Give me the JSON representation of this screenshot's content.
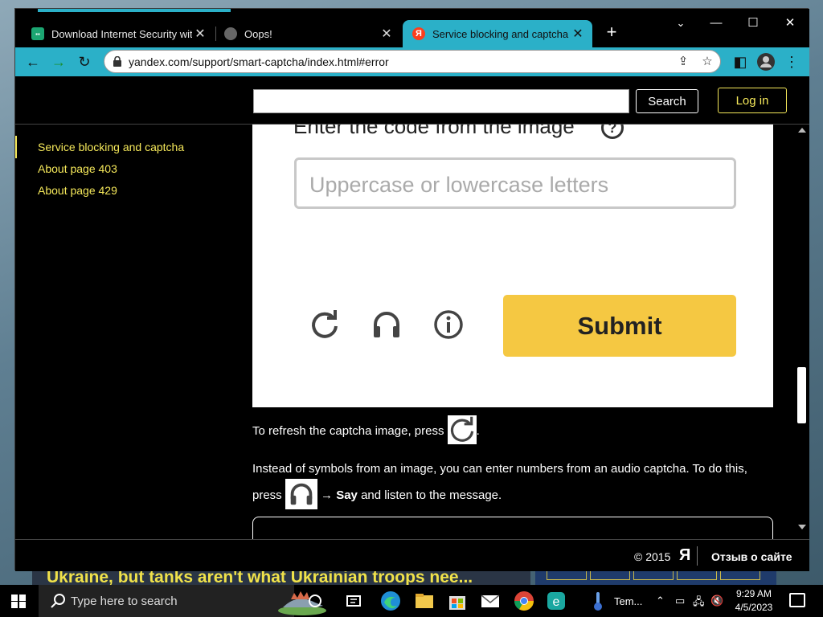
{
  "browser": {
    "tabs": [
      {
        "title": "Download Internet Security with",
        "favicon": "kaspersky-icon"
      },
      {
        "title": "Oops!",
        "favicon": "globe-icon"
      },
      {
        "title": "Service blocking and captcha",
        "favicon": "yandex-icon",
        "active": true
      }
    ],
    "new_tab": "+",
    "url": "yandex.com/support/smart-captcha/index.html#error",
    "accent_color": "#2bb0c8"
  },
  "site": {
    "search_button": "Search",
    "login_button": "Log in",
    "sidebar": [
      {
        "label": "Service blocking and captcha"
      },
      {
        "label": "About page 403"
      },
      {
        "label": "About page 429"
      }
    ],
    "captcha_image": {
      "heading": "Enter the code from the image",
      "help": "?",
      "placeholder": "Uppercase or lowercase letters",
      "submit": "Submit"
    },
    "paragraph1_before": "To refresh the captcha image, press",
    "paragraph1_after": ".",
    "paragraph2_line1": "Instead of symbols from an image, you can enter numbers from an audio captcha. To do this,",
    "paragraph2_press": "press",
    "paragraph2_arrow_say": "→ Say",
    "paragraph2_end": "and listen to the message.",
    "footer": {
      "copyright": "© 2015",
      "logo": "Я",
      "feedback": "Отзыв о сайте"
    },
    "link_color": "#f5e85a"
  },
  "background": {
    "news_text": "Ukraine, but tanks aren't what Ukrainian troops nee..."
  },
  "taskbar": {
    "search_placeholder": "Type here to search",
    "temp_app_label": "Tem...",
    "time": "9:29 AM",
    "date": "4/5/2023"
  }
}
